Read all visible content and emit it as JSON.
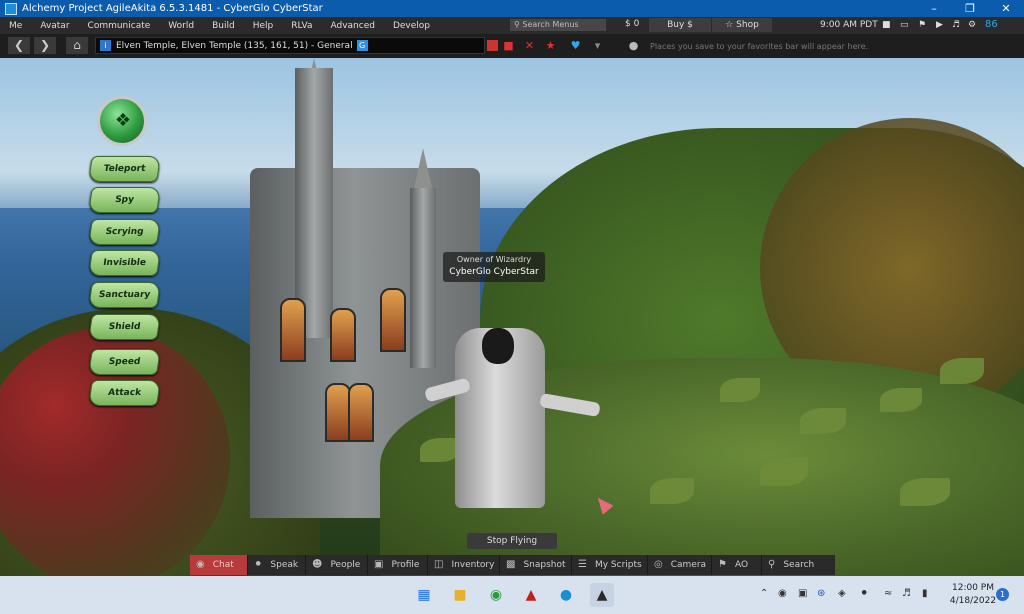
{
  "window": {
    "title": "Alchemy Project AgileAkita 6.5.3.1481 - CyberGlo CyberStar",
    "controls": {
      "minimize": "–",
      "maximize": "❐",
      "close": "✕"
    }
  },
  "menubar": {
    "items": [
      "Me",
      "Avatar",
      "Communicate",
      "World",
      "Build",
      "Help",
      "RLVa",
      "Advanced",
      "Develop"
    ],
    "search_placeholder": "Search Menus",
    "balance": "$ 0",
    "buy_label": "Buy $",
    "shop_label": "Shop",
    "time": "9:00 AM PDT",
    "fps": "86"
  },
  "navbar": {
    "location": "Elven Temple, Elven Temple (135, 161, 51) - General",
    "location_badge": "G",
    "favorites_hint": "Places you save to your favorites bar will appear here."
  },
  "hud": {
    "buttons": [
      "Teleport",
      "Spy",
      "Scrying",
      "Invisible",
      "Sanctuary",
      "Shield",
      "Speed",
      "Attack"
    ]
  },
  "nametag": {
    "title": "Owner of Wizardry",
    "name": "CyberGlo CyberStar"
  },
  "stop_flying_label": "Stop Flying",
  "toolbar": {
    "buttons": [
      {
        "label": "Chat",
        "icon": "chat-icon"
      },
      {
        "label": "Speak",
        "icon": "microphone-icon"
      },
      {
        "label": "People",
        "icon": "people-icon"
      },
      {
        "label": "Profile",
        "icon": "profile-icon"
      },
      {
        "label": "Inventory",
        "icon": "inventory-icon"
      },
      {
        "label": "Snapshot",
        "icon": "camera-snapshot-icon"
      },
      {
        "label": "My Scripts",
        "icon": "scripts-icon"
      },
      {
        "label": "Camera",
        "icon": "eye-icon"
      },
      {
        "label": "AO",
        "icon": "walk-icon"
      },
      {
        "label": "Search",
        "icon": "search-icon"
      }
    ]
  },
  "taskbar": {
    "time": "12:00 PM",
    "date": "4/18/2022",
    "notifications": "1"
  },
  "colors": {
    "titlebar": "#0b5cad",
    "chat_active": "#b83a3a",
    "fps": "#2fa8e6"
  }
}
